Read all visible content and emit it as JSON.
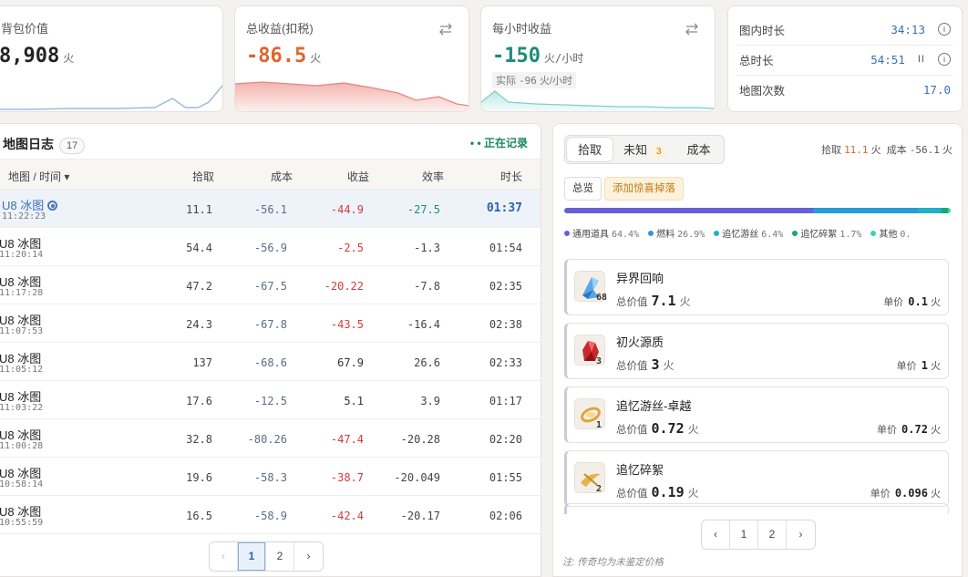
{
  "stats": {
    "bag_value": {
      "title": "背包价值",
      "value": "8,908",
      "unit": "火"
    },
    "total_profit": {
      "title": "总收益(扣税)",
      "value": "-86.5",
      "unit": "火"
    },
    "hourly_profit": {
      "title": "每小时收益",
      "value": "-150",
      "unit": "火/小时",
      "actual_label": "实际",
      "actual_value": "-96",
      "actual_unit": "火/小时"
    },
    "timers": {
      "map_time_label": "图内时长",
      "map_time": "34:13",
      "total_time_label": "总时长",
      "total_time": "54:51",
      "pause_glyph": "II",
      "map_count_label": "地图次数",
      "map_count": "17.0"
    }
  },
  "map_log": {
    "title": "地图日志",
    "count": "17",
    "recording": "• • 正在记录",
    "columns": {
      "map": "地图 / 时间 ▾",
      "pickup": "拾取",
      "cost": "成本",
      "profit": "收益",
      "eff": "效率",
      "dur": "时长"
    },
    "rows": [
      {
        "name": "U8 冰图",
        "time": "11:22:23",
        "pickup": "11.1",
        "cost": "-56.1",
        "profit": "-44.9",
        "eff": "-27.5",
        "dur": "01:37"
      },
      {
        "name": "U8 冰图",
        "time": "11:20:14",
        "pickup": "54.4",
        "cost": "-56.9",
        "profit": "-2.5",
        "eff": "-1.3",
        "dur": "01:54"
      },
      {
        "name": "U8 冰图",
        "time": "11:17:28",
        "pickup": "47.2",
        "cost": "-67.5",
        "profit": "-20.22",
        "eff": "-7.8",
        "dur": "02:35"
      },
      {
        "name": "U8 冰图",
        "time": "11:07:53",
        "pickup": "24.3",
        "cost": "-67.8",
        "profit": "-43.5",
        "eff": "-16.4",
        "dur": "02:38"
      },
      {
        "name": "U8 冰图",
        "time": "11:05:12",
        "pickup": "137",
        "cost": "-68.6",
        "profit": "67.9",
        "eff": "26.6",
        "dur": "02:33"
      },
      {
        "name": "U8 冰图",
        "time": "11:03:22",
        "pickup": "17.6",
        "cost": "-12.5",
        "profit": "5.1",
        "eff": "3.9",
        "dur": "01:17"
      },
      {
        "name": "U8 冰图",
        "time": "11:00:28",
        "pickup": "32.8",
        "cost": "-80.26",
        "profit": "-47.4",
        "eff": "-20.28",
        "dur": "02:20"
      },
      {
        "name": "U8 冰图",
        "time": "10:58:14",
        "pickup": "19.6",
        "cost": "-58.3",
        "profit": "-38.7",
        "eff": "-20.049",
        "dur": "01:55"
      },
      {
        "name": "U8 冰图",
        "time": "10:55:59",
        "pickup": "16.5",
        "cost": "-58.9",
        "profit": "-42.4",
        "eff": "-20.17",
        "dur": "02:06"
      }
    ],
    "pager": {
      "prev": "‹",
      "p1": "1",
      "p2": "2",
      "next": "›"
    }
  },
  "loot": {
    "tabs": {
      "pickup": "拾取",
      "unknown": "未知",
      "unknown_count": "3",
      "cost": "成本"
    },
    "summary": {
      "pickup_label": "拾取",
      "pickup_value": "11.1",
      "cost_label": "成本",
      "cost_value": "-56.1",
      "unit": "火"
    },
    "buttons": {
      "overview": "总览",
      "add_drop": "添加惊喜掉落"
    },
    "legend": [
      {
        "name": "通用道具",
        "pct": "64.4%",
        "share": 64.4,
        "color": "#6a5fd8"
      },
      {
        "name": "燃料",
        "pct": "26.9%",
        "share": 26.9,
        "color": "#2b9bd6"
      },
      {
        "name": "追忆游丝",
        "pct": "6.4%",
        "share": 6.4,
        "color": "#1fb0c8"
      },
      {
        "name": "追忆碎絮",
        "pct": "1.7%",
        "share": 1.7,
        "color": "#19a873"
      },
      {
        "name": "其他",
        "pct": "0.",
        "share": 0.6,
        "color": "#3fd0b0"
      }
    ],
    "items": [
      {
        "name": "异界回响",
        "qty": "68",
        "total_label": "总价值",
        "total": "7.1",
        "unit": "火",
        "unit_price_label": "单价",
        "unit_price": "0.1",
        "icon": "blue-crystal-icon"
      },
      {
        "name": "初火源质",
        "qty": "3",
        "total_label": "总价值",
        "total": "3",
        "unit": "火",
        "unit_price_label": "单价",
        "unit_price": "1",
        "icon": "red-crystal-icon"
      },
      {
        "name": "追忆游丝-卓越",
        "qty": "1",
        "total_label": "总价值",
        "total": "0.72",
        "unit": "火",
        "unit_price_label": "单价",
        "unit_price": "0.72",
        "icon": "gold-thread-icon"
      },
      {
        "name": "追忆碎絮",
        "qty": "2",
        "total_label": "总价值",
        "total": "0.19",
        "unit": "火",
        "unit_price_label": "单价",
        "unit_price": "0.096",
        "icon": "gold-fragment-icon"
      }
    ],
    "pager": {
      "prev": "‹",
      "p1": "1",
      "p2": "2",
      "next": "›"
    },
    "footnote": "注: 传奇均为未鉴定价格"
  }
}
